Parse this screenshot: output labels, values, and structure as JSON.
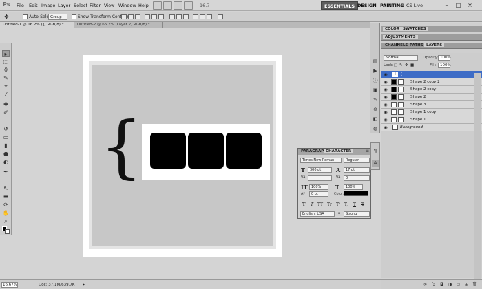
{
  "app": {
    "logo": "Ps",
    "zoom": "16.7"
  },
  "menu": [
    "File",
    "Edit",
    "Image",
    "Layer",
    "Select",
    "Filter",
    "View",
    "Window",
    "Help"
  ],
  "workspace": {
    "essentials": "ESSENTIALS",
    "design": "DESIGN",
    "painting": "PAINTING",
    "more": "»",
    "cslive": "CS Live"
  },
  "window_controls": {
    "minimize": "–",
    "maximize": "□",
    "close": "×"
  },
  "options": {
    "auto_select_label": "Auto-Select:",
    "auto_select_value": "Group",
    "transform_label": "Show Transform Controls"
  },
  "tabs": [
    {
      "label": "Untitled-1 @ 16.2% ({, RGB/8) *"
    },
    {
      "label": "Untitled-2 @ 66.7% (Layer 2, RGB/8) *"
    }
  ],
  "canvas": {
    "brace": "{"
  },
  "char_panel": {
    "tab_paragraph": "PARAGRAPH",
    "tab_character": "CHARACTER",
    "font_family": "Times New Roman",
    "font_style": "Regular",
    "font_size": "300 pt",
    "leading": "17 pt",
    "tracking": "0",
    "vscale": "100%",
    "hscale": "100%",
    "baseline": "0 pt",
    "color_label": "Color:",
    "language": "English: USA",
    "antialias": "Strong",
    "aa_label": "a",
    "style_buttons": [
      "T",
      "T",
      "TT",
      "Tr",
      "T¹",
      "T,",
      "T",
      "T"
    ]
  },
  "right_panels": {
    "group1": [
      "COLOR",
      "SWATCHES"
    ],
    "group2": [
      "ADJUSTMENTS"
    ],
    "group3": [
      "CHANNELS",
      "PATHS",
      "LAYERS"
    ]
  },
  "layers_panel": {
    "blend_mode": "Normal",
    "opacity_label": "Opacity:",
    "opacity": "100%",
    "lock_label": "Lock:",
    "fill_label": "Fill:",
    "fill": "100%",
    "layers": [
      {
        "name": "{"
      },
      {
        "name": "Shape 2 copy 2"
      },
      {
        "name": "Shape 2 copy"
      },
      {
        "name": "Shape 2"
      },
      {
        "name": "Shape 3"
      },
      {
        "name": "Shape 1 copy"
      },
      {
        "name": "Shape 1"
      },
      {
        "name": "Background"
      }
    ]
  },
  "status": {
    "zoom": "16.67%",
    "doc": "Doc: 37.1M/639.7K"
  }
}
